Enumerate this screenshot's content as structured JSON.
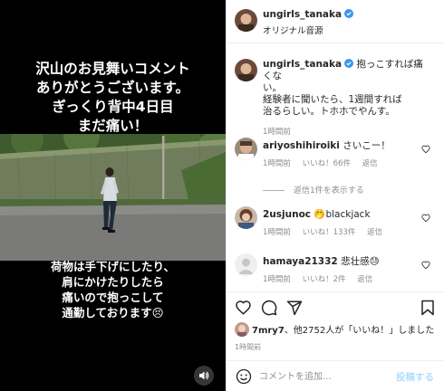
{
  "video": {
    "caption_top": [
      "沢山のお見舞いコメント",
      "ありがとうございます。",
      "ぎっくり背中4日目",
      "まだ痛い！"
    ],
    "caption_bottom": [
      "荷物は手下げにしたり、",
      "肩にかけたりしたら",
      "痛いので抱っこして",
      "通勤しております😣"
    ]
  },
  "post": {
    "username": "ungirls_tanaka",
    "audio": "オリジナル音源",
    "caption_lines": [
      "抱っこすれば痛くな",
      "い。",
      "経験者に聞いたら、1週間すれば",
      "治るらしい。トホホでやんす。"
    ],
    "caption_time": "1時間前"
  },
  "comments": [
    {
      "username": "ariyoshihiroiki",
      "text": "さいこー！",
      "time": "1時間前",
      "likes": "いいね！66件",
      "reply": "返信"
    },
    {
      "username": "2usjunoc",
      "text": "🤭blackjack",
      "time": "1時間前",
      "likes": "いいね！133件",
      "reply": "返信"
    },
    {
      "username": "hamaya21332",
      "text": "悲壮感😓",
      "time": "1時間前",
      "likes": "いいね！2件",
      "reply": "返信"
    }
  ],
  "view_replies": "返信1件を表示する",
  "likes_summary": {
    "user": "7mry7",
    "rest": "、他2752人が「いいね！」しました"
  },
  "post_time": "1時間前",
  "composer": {
    "placeholder": "コメントを追加...",
    "post_label": "投稿する"
  },
  "colors": {
    "accent_blue": "#3897f0",
    "post_button": "#b2dffc",
    "muted": "#8e8e8e"
  },
  "icons": [
    "verified-badge-icon",
    "heart-icon",
    "comment-icon",
    "share-icon",
    "bookmark-icon",
    "emoji-icon",
    "sound-icon"
  ]
}
